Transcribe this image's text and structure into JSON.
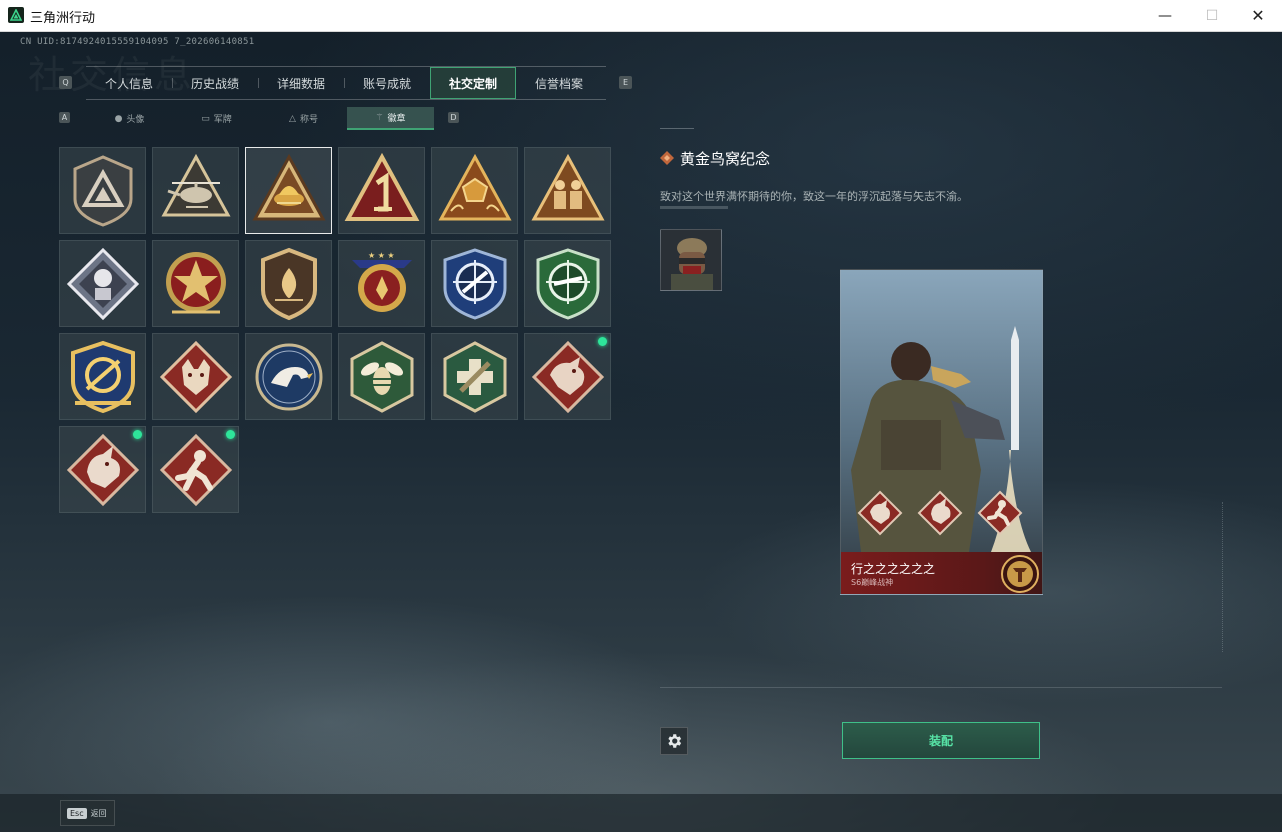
{
  "window": {
    "title": "三角洲行动",
    "minimize_glyph": "—",
    "maximize_glyph": "☐",
    "close_glyph": "✕"
  },
  "uid": "CN UID:8174924015559104095 7_202606140851",
  "watermark_title": "社交信息",
  "key_hints": {
    "prev": "Q",
    "next": "E",
    "sub_prev": "A",
    "sub_next": "D"
  },
  "main_tabs": [
    {
      "label": "个人信息"
    },
    {
      "label": "历史战绩"
    },
    {
      "label": "详细数据"
    },
    {
      "label": "账号成就"
    },
    {
      "label": "社交定制",
      "active": true
    },
    {
      "label": "信誉档案"
    }
  ],
  "sub_tabs": [
    {
      "label": "头像",
      "icon": "person-icon"
    },
    {
      "label": "军牌",
      "icon": "dogtag-icon"
    },
    {
      "label": "称号",
      "icon": "title-icon"
    },
    {
      "label": "徽章",
      "icon": "badge-icon",
      "active": true
    }
  ],
  "badges": [
    {
      "name": "badge-delta-shield",
      "selected": false,
      "new": false
    },
    {
      "name": "badge-helicopter",
      "selected": false,
      "new": false
    },
    {
      "name": "badge-golden-nest",
      "selected": true,
      "new": false
    },
    {
      "name": "badge-number-one",
      "selected": false,
      "new": false
    },
    {
      "name": "badge-dodecahedron",
      "selected": false,
      "new": false
    },
    {
      "name": "badge-soldiers",
      "selected": false,
      "new": false
    },
    {
      "name": "badge-rose-diamond",
      "selected": false,
      "new": false
    },
    {
      "name": "badge-star-wreath",
      "selected": false,
      "new": false
    },
    {
      "name": "badge-flame-shield",
      "selected": false,
      "new": false
    },
    {
      "name": "badge-stars-laurel",
      "selected": false,
      "new": false
    },
    {
      "name": "badge-blue-crosshair",
      "selected": false,
      "new": false
    },
    {
      "name": "badge-green-crosshair",
      "selected": false,
      "new": false
    },
    {
      "name": "badge-gold-crosshair",
      "selected": false,
      "new": false
    },
    {
      "name": "badge-wolf",
      "selected": false,
      "new": false
    },
    {
      "name": "badge-eagle",
      "selected": false,
      "new": false
    },
    {
      "name": "badge-wasp",
      "selected": false,
      "new": false
    },
    {
      "name": "badge-medic",
      "selected": false,
      "new": false
    },
    {
      "name": "badge-dragon-1",
      "selected": false,
      "new": true
    },
    {
      "name": "badge-dragon-2",
      "selected": false,
      "new": true
    },
    {
      "name": "badge-runner",
      "selected": false,
      "new": true
    }
  ],
  "detail": {
    "title": "黄金鸟窝纪念",
    "description": "致对这个世界满怀期待的你，致这一年的浮沉起落与矢志不渝。"
  },
  "card": {
    "player_name": "行之之之之之之",
    "rank": "S6巅峰战神"
  },
  "equip_label": "装配",
  "back": {
    "key": "Esc",
    "label": "返回"
  },
  "colors": {
    "accent_green": "#3fa374",
    "new_dot": "#2ee59a",
    "card_footer_red": "#7a1c1c"
  }
}
